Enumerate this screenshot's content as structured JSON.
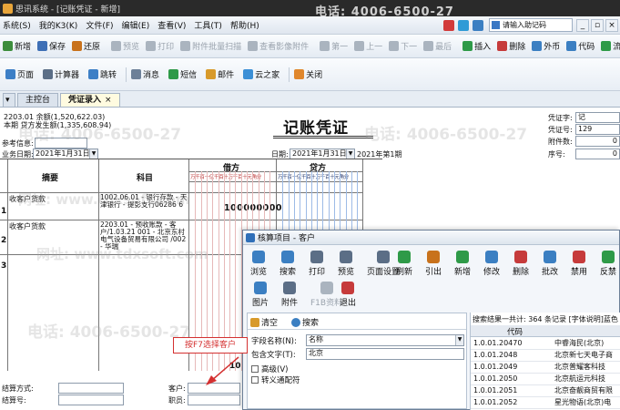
{
  "window": {
    "title": "思讯系统 - [记账凭证 - 新增]"
  },
  "menus": [
    "系统(S)",
    "我的K3(K)",
    "文件(F)",
    "编辑(E)",
    "查看(V)",
    "工具(T)",
    "帮助(H)"
  ],
  "search": {
    "placeholder": "请输入助记码"
  },
  "toolbar": [
    {
      "label": "新增",
      "color": "#3c8d3c",
      "enabled": true
    },
    {
      "label": "保存",
      "color": "#3d6fb6",
      "enabled": true
    },
    {
      "label": "还原",
      "color": "#c8721c",
      "enabled": true
    },
    {
      "label": "预览",
      "color": "#aab4bf",
      "enabled": false
    },
    {
      "label": "打印",
      "color": "#aab4bf",
      "enabled": false
    },
    {
      "label": "附件批量扫描",
      "color": "#aab4bf",
      "enabled": false
    },
    {
      "label": "查看影像附件",
      "color": "#aab4bf",
      "enabled": false
    },
    {
      "label": "第一",
      "color": "#aab4bf",
      "enabled": false
    },
    {
      "label": "上一",
      "color": "#aab4bf",
      "enabled": false
    },
    {
      "label": "下一",
      "color": "#aab4bf",
      "enabled": false
    },
    {
      "label": "最后",
      "color": "#aab4bf",
      "enabled": false
    },
    {
      "label": "插入",
      "color": "#2e9a48",
      "enabled": true
    },
    {
      "label": "删除",
      "color": "#c63b3b",
      "enabled": true
    },
    {
      "label": "外币",
      "color": "#3b7fc2",
      "enabled": true
    },
    {
      "label": "代码",
      "color": "#3b7fc2",
      "enabled": true
    },
    {
      "label": "流量",
      "color": "#2e9a48",
      "enabled": true
    }
  ],
  "toolbar2": [
    {
      "label": "页面",
      "color": "#3d7fc6"
    },
    {
      "label": "计算器",
      "color": "#5b6e86"
    },
    {
      "label": "跳转",
      "color": "#3d7fc6"
    },
    {
      "label": "消息",
      "color": "#6d8098"
    },
    {
      "label": "短信",
      "color": "#2e9a48"
    },
    {
      "label": "邮件",
      "color": "#d89a2a"
    },
    {
      "label": "云之家",
      "color": "#3b8fd6"
    },
    {
      "label": "关闭",
      "color": "#e0872c"
    }
  ],
  "tabs": [
    {
      "label": "主控台",
      "active": false
    },
    {
      "label": "凭证录入",
      "active": true,
      "close": "×"
    }
  ],
  "voucher": {
    "account_line1": "2203.01  余额(1,520,622.03)",
    "account_line2": "本期 贷方发生额(1,335,608.94)",
    "title": "记账凭证",
    "ref_label": "参考信息:",
    "biz_date_label": "业务日期:",
    "biz_date": "2021年1月31日",
    "date_label": "日期:",
    "date": "2021年1月31日",
    "period": "2021年第1期",
    "voucher_word_label": "凭证字:",
    "voucher_word": "记",
    "voucher_no_label": "凭证号:",
    "voucher_no": "129",
    "attach_label": "附件数:",
    "attach": "0",
    "seq_label": "序号:",
    "seq": "0",
    "col_summary": "摘要",
    "col_account": "科目",
    "col_debit": "借方",
    "col_credit": "贷方",
    "digit_header": "万千百十亿千百十万千百十元角分",
    "rows": [
      {
        "no": "1",
        "summary": "收客户货款",
        "account": "1002.06.01 - 银行存款 - 天津银行 - 提彭支行06286 6",
        "debit": "100000000"
      },
      {
        "no": "2",
        "summary": "收客户货款",
        "account": "2203.01 - 预收账款 - 客户/1.03.21 001 - 北京东村电气设备贸易有限公司 /002 - 华瑞",
        "debit": ""
      },
      {
        "no": "3",
        "summary": "",
        "account": "",
        "debit": ""
      }
    ],
    "total_debit": "10",
    "settle_method_label": "结算方式:",
    "settle_no_label": "结算号:",
    "customer_label": "客户:",
    "staff_label": "职员:"
  },
  "callout": {
    "text": "按F7选择客户"
  },
  "popup": {
    "title": "核算项目 - 客户",
    "tools1": [
      {
        "label": "浏览",
        "color": "#3b7fc2",
        "enabled": true
      },
      {
        "label": "搜索",
        "color": "#3b7fc2",
        "enabled": true
      },
      {
        "label": "打印",
        "color": "#5b6e86",
        "enabled": true
      },
      {
        "label": "预览",
        "color": "#5b6e86",
        "enabled": true
      },
      {
        "label": "页面设置",
        "color": "#5b6e86",
        "enabled": true
      },
      {
        "label": "刷新",
        "color": "#2e9a48",
        "enabled": true
      },
      {
        "label": "引出",
        "color": "#c8721c",
        "enabled": true
      },
      {
        "label": "新增",
        "color": "#2e9a48",
        "enabled": true
      },
      {
        "label": "修改",
        "color": "#3b7fc2",
        "enabled": true
      },
      {
        "label": "删除",
        "color": "#c63b3b",
        "enabled": true
      },
      {
        "label": "批改",
        "color": "#3b7fc2",
        "enabled": true
      },
      {
        "label": "禁用",
        "color": "#c63b3b",
        "enabled": true
      },
      {
        "label": "反禁",
        "color": "#2e9a48",
        "enabled": true
      }
    ],
    "tools2": [
      {
        "label": "图片",
        "color": "#3b7fc2",
        "enabled": true
      },
      {
        "label": "附件",
        "color": "#5b6e86",
        "enabled": true
      },
      {
        "label": "F1B资料",
        "color": "#aab4bf",
        "enabled": false
      },
      {
        "label": "退出",
        "color": "#c63b3b",
        "enabled": true
      }
    ],
    "clear_label": "清空",
    "search_label": "搜索",
    "field_label": "字段名称(N):",
    "field_value": "名称",
    "contains_label": "包含文字(T):",
    "contains_value": "北京",
    "advanced_label": "高级(V)",
    "escape_label": "转义通配符",
    "result_summary": "搜索结果一共计: 364 条记录   [字体说明]蓝色",
    "result_col": "代码",
    "results": [
      {
        "code": "1.0.01.20470",
        "name": "中睿海民(北京)"
      },
      {
        "code": "1.0.01.2048",
        "name": "北京新七天电子商"
      },
      {
        "code": "1.0.01.2049",
        "name": "北京普耀客科技"
      },
      {
        "code": "1.0.01.2050",
        "name": "北京航运元科技"
      },
      {
        "code": "1.0.01.2051",
        "name": "北京奋靓商贸有限"
      },
      {
        "code": "1.0.01.2052",
        "name": "星光物语(北京)电"
      }
    ]
  },
  "watermarks": [
    {
      "text": "电话: 4006-6500-27"
    },
    {
      "text": "网址: www.tdxsoft.com"
    }
  ]
}
